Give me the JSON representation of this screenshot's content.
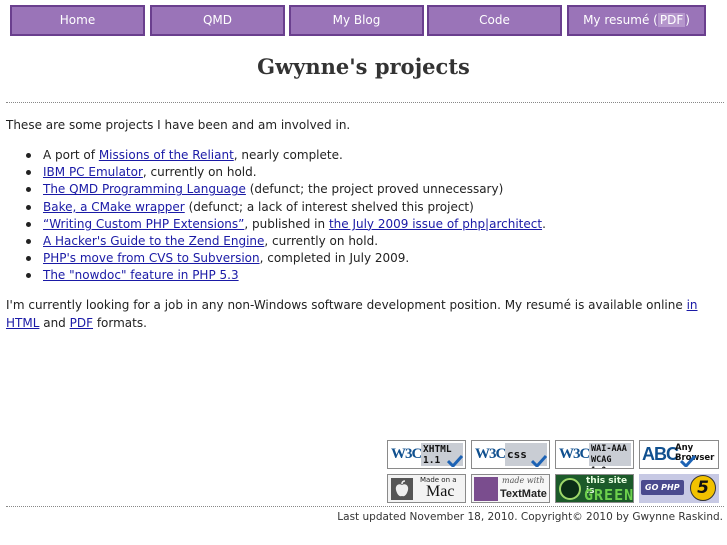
{
  "nav": {
    "home": "Home",
    "qmd": "QMD",
    "blog": "My Blog",
    "code": "Code",
    "resume": "My resumé",
    "resume_pdf_open": " (",
    "resume_pdf": "PDF",
    "resume_pdf_close": ")"
  },
  "page_title": "Gwynne's projects",
  "intro": "These are some projects I have been and am involved in.",
  "projects": [
    {
      "pre": "A port of ",
      "link": "Missions of the Reliant",
      "post": ", nearly complete."
    },
    {
      "pre": "",
      "link": "IBM PC Emulator",
      "post": ", currently on hold."
    },
    {
      "pre": "",
      "link": "The QMD Programming Language",
      "post": " (defunct; the project proved unnecessary)"
    },
    {
      "pre": "",
      "link": "Bake, a CMake wrapper",
      "post": " (defunct; a lack of interest shelved this project)"
    },
    {
      "pre": "",
      "link": "“Writing Custom PHP Extensions”",
      "mid": ", published in ",
      "link2": "the July 2009 issue of php|architect",
      "post": "."
    },
    {
      "pre": "",
      "link": "A Hacker's Guide to the Zend Engine",
      "post": ", currently on hold."
    },
    {
      "pre": "",
      "link": "PHP's move from CVS to Subversion",
      "post": ", completed in July 2009."
    },
    {
      "pre": "",
      "link": "The \"nowdoc\" feature in PHP 5.3",
      "post": ""
    }
  ],
  "job": {
    "text1": "I'm currently looking for a job in any non-Windows software development position. My resumé is available online ",
    "html_link": "in HTML",
    "text2": " and ",
    "pdf_link": "PDF",
    "text3": " formats."
  },
  "badges": {
    "xhtml": {
      "w3": "W3C",
      "l1": "XHTML",
      "l2": "1.1"
    },
    "css": {
      "w3": "W3C",
      "l1": "css"
    },
    "wai": {
      "w3": "W3C",
      "l1": "WAI-AAA",
      "l2": "WCAG 1.0"
    },
    "anybrowser": {
      "abc": "ABC",
      "l1": "Any",
      "l2": "Browser"
    },
    "mac": {
      "made": "Made on a",
      "mac": "Mac"
    },
    "textmate": {
      "made": "made with",
      "name": "TextMate"
    },
    "green": {
      "l1": "this site is",
      "l2": "GREEN"
    },
    "php": {
      "go": "GO PHP",
      "five": "5"
    }
  },
  "footer": "Last updated November 18, 2010. Copyright© 2010 by Gwynne Raskind.",
  "colors": {
    "nav_bg": "#9a74b8",
    "nav_border": "#6a3f8e",
    "link": "#1a1aa6",
    "w3c_blue": "#10508f"
  }
}
